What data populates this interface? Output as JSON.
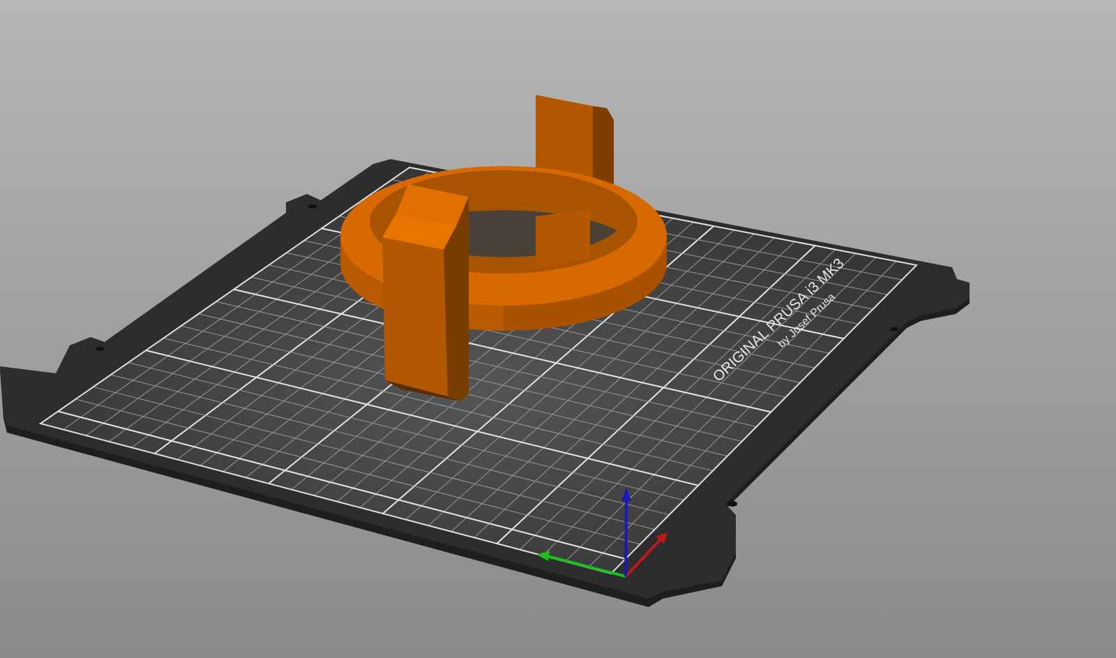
{
  "view": {
    "name": "3D plater view"
  },
  "bed": {
    "label_main": "ORIGINAL PRUSA i3 MK3",
    "label_sub": "by Josef Prusa",
    "colors": {
      "plate": "#2b2b2b",
      "grid_surface": "#3c3c3c",
      "grid_line": "#d8d8d8"
    }
  },
  "object": {
    "color_light": "#e06c00",
    "color_mid": "#b85a00",
    "color_dark": "#7a3d00"
  },
  "axes": {
    "x_color": "#c01010",
    "y_color": "#10c010",
    "z_color": "#1010c0"
  },
  "colors": {
    "background_top": "#b4b4b4",
    "background_bottom": "#8a8a8a"
  }
}
